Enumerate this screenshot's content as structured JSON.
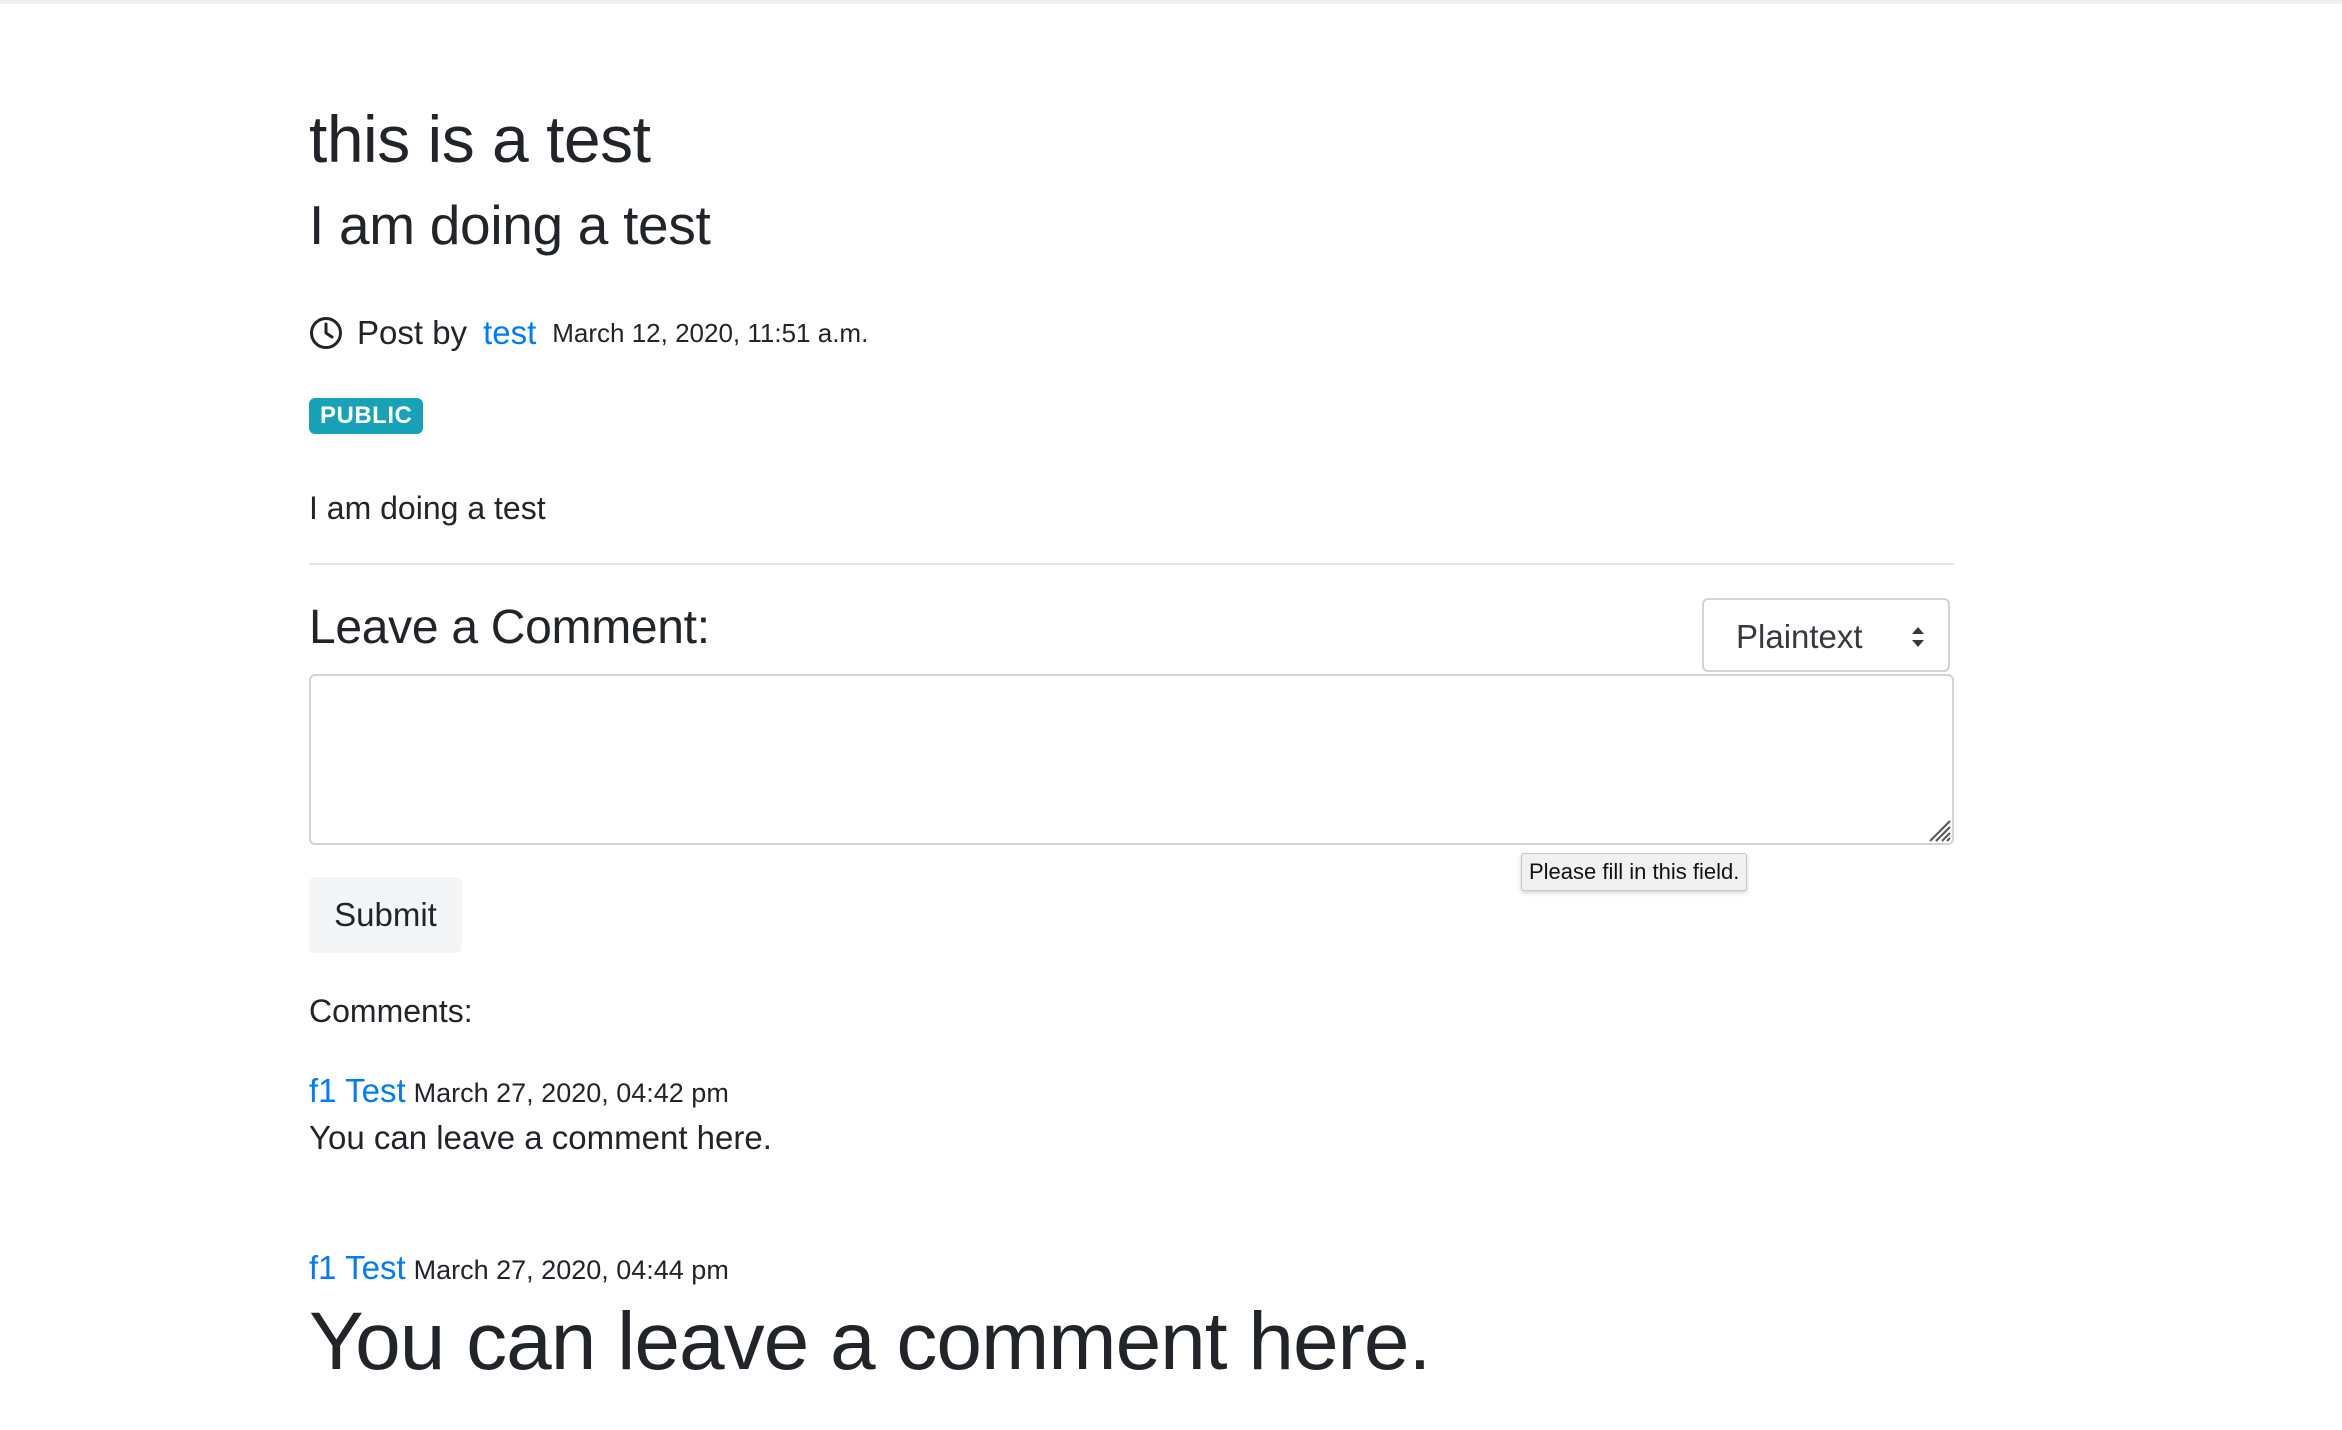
{
  "post": {
    "title": "this is a test",
    "subtitle": "I am doing a test",
    "post_by_label": "Post by",
    "author": "test",
    "date": "March 12, 2020, 11:51 a.m.",
    "visibility_badge": "PUBLIC",
    "body": "I am doing a test"
  },
  "comment_form": {
    "heading": "Leave a Comment:",
    "format_select": {
      "selected": "Plaintext"
    },
    "textarea_value": "",
    "validation_tooltip": "Please fill in this field.",
    "submit_label": "Submit"
  },
  "comments": {
    "label": "Comments:",
    "items": [
      {
        "author": "f1 Test",
        "date": "March 27, 2020, 04:42 pm",
        "text": "You can leave a comment here."
      },
      {
        "author": "f1 Test",
        "date": "March 27, 2020, 04:44 pm",
        "text": "You can leave a comment here."
      }
    ]
  },
  "colors": {
    "link": "#007bff",
    "badge": "#17a2b8",
    "text": "#212529"
  },
  "icons": {
    "clock": "clock-icon",
    "select_arrows": "select-arrows-icon",
    "resize": "resize-grip-icon"
  }
}
